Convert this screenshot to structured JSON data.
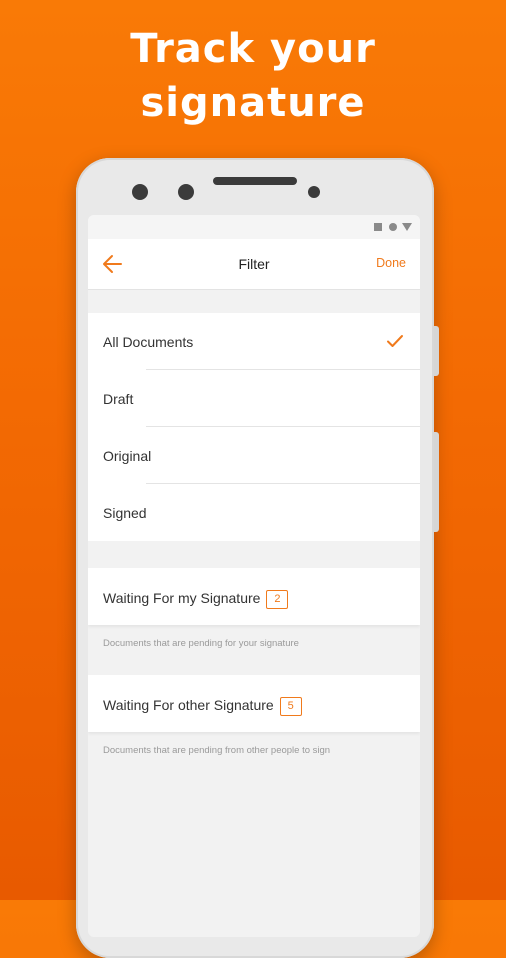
{
  "headline": {
    "line1": "Track your",
    "line2": "signature"
  },
  "colors": {
    "accent": "#f07a1c",
    "background": "#f47004"
  },
  "toolbar": {
    "title": "Filter",
    "done_label": "Done",
    "back_icon": "arrow-left-icon"
  },
  "filters": [
    {
      "label": "All Documents",
      "selected": true
    },
    {
      "label": "Draft",
      "selected": false
    },
    {
      "label": "Original",
      "selected": false
    },
    {
      "label": "Signed",
      "selected": false
    }
  ],
  "waiting_mine": {
    "label": "Waiting For my Signature",
    "count": "2",
    "hint": "Documents that are pending for your signature"
  },
  "waiting_others": {
    "label": "Waiting For other Signature",
    "count": "5",
    "hint": "Documents that are pending from other people to sign"
  }
}
